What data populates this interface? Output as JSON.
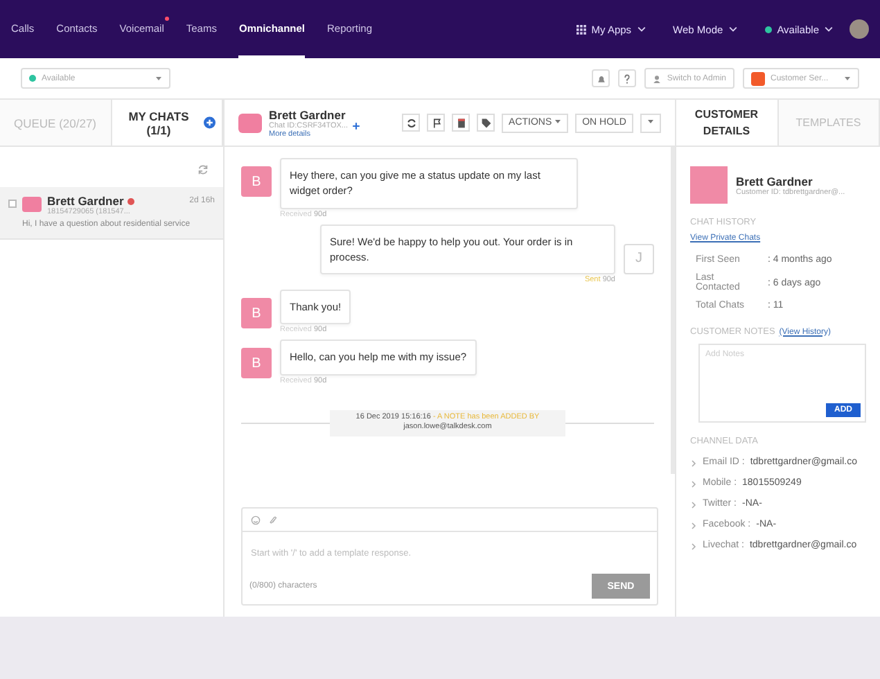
{
  "nav": {
    "items": [
      {
        "label": "Calls",
        "selected": false,
        "badge": false
      },
      {
        "label": "Contacts",
        "selected": false,
        "badge": false
      },
      {
        "label": "Voicemail",
        "selected": false,
        "badge": true
      },
      {
        "label": "Teams",
        "selected": false,
        "badge": false
      },
      {
        "label": "Omnichannel",
        "selected": true,
        "badge": false
      },
      {
        "label": "Reporting",
        "selected": false,
        "badge": false
      }
    ],
    "my_apps": "My Apps",
    "web_mode": "Web Mode",
    "status": {
      "label": "Available",
      "color": "#2ec4a0"
    }
  },
  "toolbar": {
    "status_select": {
      "label": "Available",
      "color": "#2ec4a0"
    },
    "switch_admin": "Switch to Admin",
    "queue_select": "Customer Ser..."
  },
  "left": {
    "tabs": [
      {
        "label": "QUEUE (20/27)",
        "selected": false
      },
      {
        "label": "MY CHATS (1/1)",
        "selected": true
      }
    ],
    "chats": [
      {
        "name": "Brett Gardner",
        "unread": true,
        "phone": "18154729065 (181547...",
        "time": "2d 16h",
        "preview": "Hi, I have a question about residential service",
        "selected": true
      }
    ]
  },
  "chat": {
    "name": "Brett Gardner",
    "chat_id": "Chat ID:CSRF34TOX...",
    "more": "More details",
    "actions": "ACTIONS",
    "hold": "ON HOLD",
    "messages": [
      {
        "kind": "incoming",
        "avatar": "B",
        "text": "Hey there, can you give me a status update on my last widget order?",
        "status": "Received",
        "time": "90d"
      },
      {
        "kind": "outgoing",
        "avatar": "J",
        "text": "Sure! We'd be happy to help you out. Your order is in process.",
        "status": "Sent",
        "time": "90d"
      },
      {
        "kind": "incoming",
        "avatar": "B",
        "text": "Thank you!",
        "status": "Received",
        "time": "90d"
      },
      {
        "kind": "incoming",
        "avatar": "B",
        "text": "Hello, can you help me with my issue?",
        "status": "Received",
        "time": "90d"
      }
    ],
    "note": {
      "time": "16 Dec 2019 15:16:16",
      "text": "- A NOTE has been ADDED BY",
      "author": "jason.lowe@talkdesk.com"
    },
    "composer": {
      "placeholder": "Start with '/' to add a template response.",
      "counter": "(0/800) characters",
      "send": "SEND",
      "send_disabled": true
    }
  },
  "right": {
    "tabs": [
      {
        "label": "CUSTOMER DETAILS",
        "selected": true
      },
      {
        "label": "TEMPLATES",
        "selected": false
      }
    ],
    "name": "Brett Gardner",
    "customer_id": "Customer ID: tdbrettgardner@...",
    "history_heading": "CHAT HISTORY",
    "history_link": "View Private Chats",
    "stats": [
      {
        "label": "First Seen",
        "value": ": 4 months ago"
      },
      {
        "label": "Last Contacted",
        "value": ": 6 days ago"
      },
      {
        "label": "Total Chats",
        "value": ": 11"
      }
    ],
    "notes_heading": "CUSTOMER NOTES",
    "notes_link": "(View History)",
    "notes_placeholder": "Add Notes",
    "add": "ADD",
    "channel_heading": "CHANNEL DATA",
    "channels": [
      {
        "label": "Email ID :",
        "value": "tdbrettgardner@gmail.co"
      },
      {
        "label": "Mobile :",
        "value": "18015509249"
      },
      {
        "label": "Twitter :",
        "value": "-NA-"
      },
      {
        "label": "Facebook :",
        "value": "-NA-"
      },
      {
        "label": "Livechat :",
        "value": "tdbrettgardner@gmail.co"
      }
    ]
  }
}
